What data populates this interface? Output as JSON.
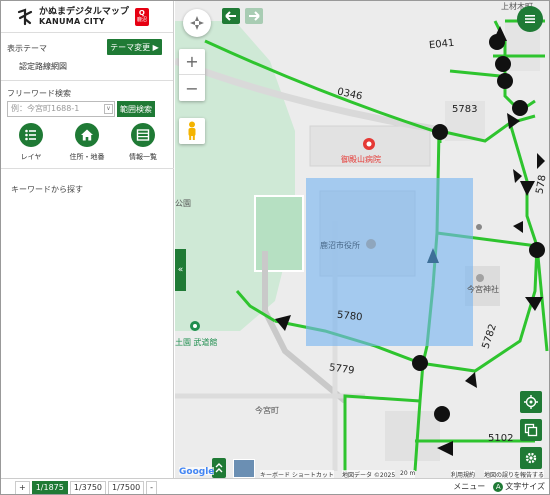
{
  "brand": {
    "title_ja": "かぬまデジタルマップ",
    "title_en": "KANUMA CITY",
    "badge_line1": "Q",
    "badge_line2": "鹿沼"
  },
  "theme": {
    "label": "表示テーマ",
    "change_button": "テーマ変更 ▶",
    "current": "認定路線網図"
  },
  "search": {
    "label": "フリーワード検索",
    "placeholder": "例：今宮町1688-1",
    "dropdown": "∨",
    "range_button": "範囲検索"
  },
  "quick": [
    {
      "label": "レイヤ",
      "icon": "layer-list-icon"
    },
    {
      "label": "住所・地番",
      "icon": "home-icon"
    },
    {
      "label": "情報一覧",
      "icon": "table-list-icon"
    }
  ],
  "keyword_label": "キーワードから探す",
  "collapse_label": "«",
  "map": {
    "labels": {
      "route_0346": "0346",
      "route_e041": "E041",
      "route_5783": "5783",
      "route_5780": "5780",
      "route_5779": "5779",
      "route_5782": "5782",
      "route_5102": "5102",
      "route_578": "578",
      "hospital": "御殿山病院",
      "city_hall": "鹿沼市役所",
      "shrine": "今宮神社",
      "park": "公園",
      "budokan": "土園 武道館",
      "town": "今宮町",
      "kamishuku": "上材木町"
    },
    "zoom_in": "+",
    "zoom_out": "−",
    "attribution": {
      "google": "Google",
      "shortcuts": "キーボード ショートカット",
      "mapdata": "地図データ ©2025",
      "scale": "20 m",
      "terms": "利用規約",
      "report": "地図の誤りを報告する"
    }
  },
  "footer": {
    "scales": [
      "1/1875",
      "1/3750",
      "1/7500",
      "-"
    ],
    "plus": "+",
    "menu_label": "メニュー",
    "font_size_label": "文字サイズ",
    "font_size_icon": "A"
  },
  "colors": {
    "accent": "#1f7a35",
    "route": "#2ec42e",
    "selection": "#7ab8f0",
    "hospital": "#e53935"
  }
}
